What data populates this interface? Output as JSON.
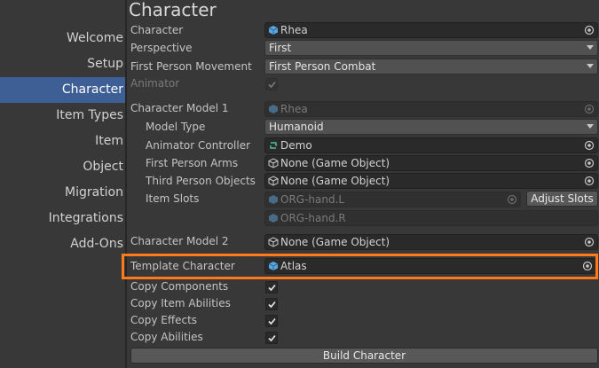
{
  "nav": {
    "items": [
      {
        "label": "Welcome",
        "active": false
      },
      {
        "label": "Setup",
        "active": false
      },
      {
        "label": "Character",
        "active": true
      },
      {
        "label": "Item Types",
        "active": false
      },
      {
        "label": "Item",
        "active": false
      },
      {
        "label": "Object",
        "active": false
      },
      {
        "label": "Migration",
        "active": false
      },
      {
        "label": "Integrations",
        "active": false
      },
      {
        "label": "Add-Ons",
        "active": false
      }
    ]
  },
  "main": {
    "title": "Character",
    "character": {
      "label": "Character",
      "value": "Rhea"
    },
    "perspective": {
      "label": "Perspective",
      "value": "First"
    },
    "fp_movement": {
      "label": "First Person Movement",
      "value": "First Person Combat"
    },
    "animator": {
      "label": "Animator",
      "checked": true
    },
    "model1": {
      "label": "Character Model 1",
      "value": "Rhea",
      "model_type": {
        "label": "Model Type",
        "value": "Humanoid"
      },
      "animator_controller": {
        "label": "Animator Controller",
        "value": "Demo"
      },
      "fp_arms": {
        "label": "First Person Arms",
        "value": "None (Game Object)"
      },
      "tp_objects": {
        "label": "Third Person Objects",
        "value": "None (Game Object)"
      },
      "item_slots": {
        "label": "Item Slots",
        "slots": [
          "ORG-hand.L",
          "ORG-hand.R"
        ],
        "adjust_label": "Adjust Slots"
      }
    },
    "model2": {
      "label": "Character Model 2",
      "value": "None (Game Object)"
    },
    "template": {
      "label": "Template Character",
      "value": "Atlas"
    },
    "copy_components": {
      "label": "Copy Components",
      "checked": true
    },
    "copy_item_abilities": {
      "label": "Copy Item Abilities",
      "checked": true
    },
    "copy_effects": {
      "label": "Copy Effects",
      "checked": true
    },
    "copy_abilities": {
      "label": "Copy Abilities",
      "checked": true
    },
    "build_label": "Build Character"
  },
  "colors": {
    "accent": "#3e5f96",
    "highlight": "#ff7a1a"
  }
}
